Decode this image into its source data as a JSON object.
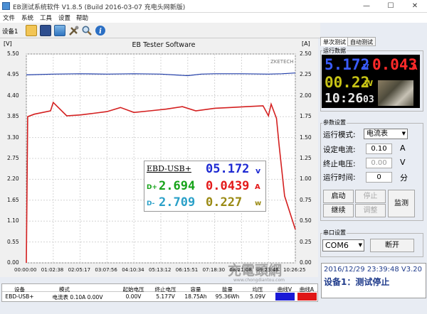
{
  "window": {
    "title": "EB测试系统软件 V1.8.5 (Build 2016-03-07 充电头网新版)",
    "min": "—",
    "max": "☐",
    "close": "✕"
  },
  "menu": [
    "文件",
    "系统",
    "工具",
    "设置",
    "帮助"
  ],
  "toolbar": {
    "device_label": "设备1",
    "icons": [
      "folder-open-icon",
      "save-icon",
      "monitor-icon",
      "tools-icon",
      "search-icon",
      "info-icon"
    ]
  },
  "chart": {
    "title": "EB Tester Software",
    "watermark_brand": "ZKETECH",
    "unit_left": "[V]",
    "unit_right": "[A]",
    "watermark": "充電頭網",
    "watermark_url": "www.chongdiantou.com",
    "lcd_overlay": {
      "device": "EBD-USB+",
      "voltage": "05.172",
      "voltage_unit": "v",
      "dplus_label": "D+",
      "dplus": "2.694",
      "current": "0.0439",
      "current_unit": "A",
      "dminus_label": "D-",
      "dminus": "2.709",
      "power": "0.227",
      "power_unit": "w"
    }
  },
  "chart_data": {
    "type": "line",
    "title": "EB Tester Software",
    "xlabel": "",
    "ylabel": "[V]",
    "ylabel_right": "[A]",
    "grid": true,
    "ylim": [
      0,
      5.5
    ],
    "ylim_right": [
      0,
      2.5
    ],
    "yticks_left": [
      "5.50",
      "4.95",
      "4.40",
      "3.85",
      "3.30",
      "2.75",
      "2.20",
      "1.65",
      "1.10",
      "0.55",
      "0.00"
    ],
    "yticks_right": [
      "2.50",
      "2.25",
      "2.00",
      "1.75",
      "1.50",
      "1.25",
      "1.00",
      "0.75",
      "0.50",
      "0.25",
      "0.00"
    ],
    "xticks": [
      "00:00:00",
      "01:02:38",
      "02:05:17",
      "03:07:56",
      "04:10:34",
      "05:13:12",
      "06:15:51",
      "07:18:30",
      "08:21:08",
      "09:23:46",
      "10:26:25"
    ],
    "series": [
      {
        "name": "曲线V",
        "color": "#1f3ca8",
        "x": [
          0,
          1,
          2,
          3,
          4,
          5,
          6,
          6.5,
          7,
          8,
          9,
          9.5,
          10
        ],
        "y": [
          4.95,
          4.97,
          4.98,
          4.97,
          4.98,
          4.97,
          4.93,
          4.97,
          4.98,
          4.98,
          4.97,
          4.98,
          5.0
        ]
      },
      {
        "name": "曲线A",
        "color": "#d42020",
        "x": [
          0,
          0.05,
          0.3,
          0.9,
          1.0,
          1.5,
          2.0,
          2.5,
          3.0,
          3.5,
          4.0,
          4.6,
          5.2,
          5.8,
          6.3,
          7.0,
          7.6,
          8.2,
          8.8,
          9.0,
          9.1,
          9.3,
          9.4,
          9.6,
          10.0
        ],
        "y": [
          0.0,
          1.75,
          1.78,
          1.82,
          1.92,
          1.76,
          1.77,
          1.79,
          1.81,
          1.86,
          1.8,
          1.82,
          1.84,
          1.87,
          1.82,
          1.85,
          1.86,
          1.87,
          1.88,
          1.76,
          1.9,
          1.73,
          1.4,
          0.8,
          0.4
        ]
      }
    ]
  },
  "table": {
    "headers": [
      "设备",
      "模式",
      "起始电压",
      "终止电压",
      "容量",
      "能量",
      "均压",
      "曲线V",
      "曲线A"
    ],
    "row": [
      "EBD-USB+",
      "电流表 0.10A 0.00V",
      "0.00V",
      "5.177V",
      "18.75Ah",
      "95.36Wh",
      "5.09V",
      "",
      ""
    ],
    "colors": {
      "curve_v": "#1a1ad6",
      "curve_a": "#e01616"
    }
  },
  "tabs": [
    "单次测试",
    "自动测试"
  ],
  "run_data": {
    "label": "运行数据",
    "voltage": "5.172",
    "voltage_unit": "V",
    "current": "0.043",
    "current_unit": "A",
    "power": "00.22",
    "power_unit": "W",
    "time": "10:26",
    "time_sec": "03"
  },
  "params": {
    "label": "参数设置",
    "mode_label": "运行模式:",
    "mode_value": "电流表",
    "current_label": "设定电流:",
    "current_value": "0.10",
    "current_unit": "A",
    "stop_v_label": "终止电压:",
    "stop_v_value": "0.00",
    "stop_v_unit": "V",
    "runtime_label": "运行时间:",
    "runtime_value": "0",
    "runtime_unit": "分",
    "buttons": {
      "start": "启动",
      "stop": "停止",
      "monitor": "监测",
      "continue": "继续",
      "adjust": "调整"
    }
  },
  "port": {
    "label": "串口设置",
    "value": "COM6",
    "disconnect": "断开"
  },
  "status": {
    "time": "2016/12/29 23:39:48 V3.20",
    "message": "设备1：测试停止"
  }
}
